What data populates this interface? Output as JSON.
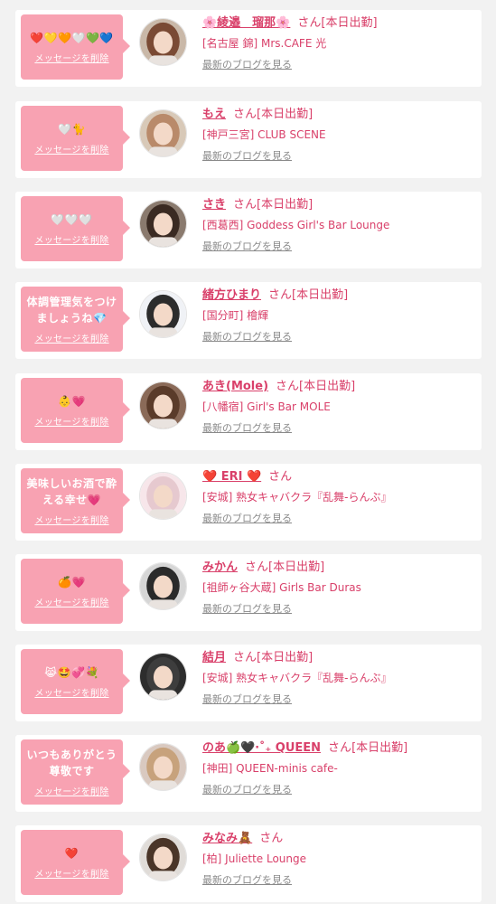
{
  "accent_color": "#d9406a",
  "bubble_color": "#f8a2b2",
  "delete_label": "メッセージを削除",
  "blog_label": "最新のブログを見る",
  "items": [
    {
      "message": "❤️💛🧡🤍💚💙",
      "name": "🌸綾邉　瑠那🌸",
      "suffix": "さん",
      "status": "[本日出勤]",
      "shop": "[名古屋 錦] Mrs.CAFE 光",
      "avatar": "woman-avatar-icon"
    },
    {
      "message": "🤍🐈",
      "name": "もえ",
      "suffix": "さん",
      "status": "[本日出勤]",
      "shop": "[神戸三宮] CLUB SCENE",
      "avatar": "woman-avatar-icon"
    },
    {
      "message": "🤍🤍🤍",
      "name": "さき",
      "suffix": "さん",
      "status": "[本日出勤]",
      "shop": "[西葛西] Goddess Girl's Bar Lounge",
      "avatar": "woman-avatar-icon"
    },
    {
      "message": "体調管理気をつけ\nましょうね💎",
      "name": "緒方ひまり",
      "suffix": "さん",
      "status": "[本日出勤]",
      "shop": "[国分町] 檜輝",
      "avatar": "woman-avatar-icon"
    },
    {
      "message": "👶💗",
      "name": "あき(Mole)",
      "suffix": "さん",
      "status": "[本日出勤]",
      "shop": "[八幡宿] Girl's Bar MOLE",
      "avatar": "woman-avatar-icon"
    },
    {
      "message": "美味しいお酒で酔\nえる幸せ💗",
      "name": "❤️ ERI ❤️",
      "suffix": "さん",
      "status": "",
      "shop": "[安城] 熟女キャバクラ『乱舞-らんぶ』",
      "avatar": "woman-avatar-icon"
    },
    {
      "message": "🍊💗",
      "name": "みかん",
      "suffix": "さん",
      "status": "[本日出勤]",
      "shop": "[祖師ヶ谷大蔵] Girls Bar Duras",
      "avatar": "woman-avatar-icon"
    },
    {
      "message": "😹🤩💞💐",
      "name": "結月",
      "suffix": "さん",
      "status": "[本日出勤]",
      "shop": "[安城] 熟女キャバクラ『乱舞-らんぶ』",
      "avatar": "woman-avatar-icon"
    },
    {
      "message": "いつもありがとう\n尊敬です",
      "name": "のあ🍏🖤‧˚₊ QUEEN",
      "suffix": "さん",
      "status": "[本日出勤]",
      "shop": "[神田] QUEEN-minis cafe-",
      "avatar": "woman-avatar-icon"
    },
    {
      "message": "❤️",
      "name": "みなみ🧸",
      "suffix": "さん",
      "status": "",
      "shop": "[柏] Juliette Lounge",
      "avatar": "woman-avatar-icon"
    }
  ]
}
